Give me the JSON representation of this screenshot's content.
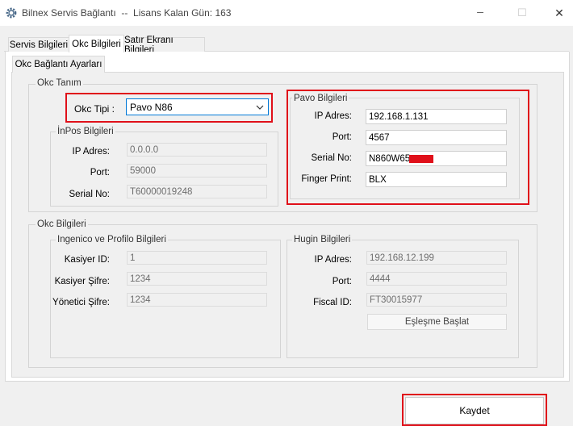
{
  "window": {
    "title": "Bilnex Servis Bağlantı  --  Lisans Kalan Gün: 163",
    "minimize_glyph": "─",
    "maximize_glyph": "☐",
    "close_glyph": "✕"
  },
  "tabs": [
    {
      "label": "Servis Bilgileri"
    },
    {
      "label": "Okc Bilgileri",
      "active": true
    },
    {
      "label": "Satır Ekranı Bilgileri"
    }
  ],
  "subtab": {
    "label": "Okc Bağlantı Ayarları"
  },
  "okc_tanim": {
    "legend": "Okc Tanım",
    "okc_tipi": {
      "label": "Okc Tipi :",
      "value": "Pavo N86"
    },
    "inpos": {
      "legend": "İnPos Bilgileri",
      "ip": {
        "label": "IP Adres:",
        "value": "0.0.0.0"
      },
      "port": {
        "label": "Port:",
        "value": "59000"
      },
      "serial": {
        "label": "Serial No:",
        "value": "T60000019248"
      }
    },
    "pavo": {
      "legend": "Pavo Bilgileri",
      "ip": {
        "label": "IP Adres:",
        "value": "192.168.1.131"
      },
      "port": {
        "label": "Port:",
        "value": "4567"
      },
      "serial": {
        "label": "Serial No:",
        "value": "N860W65"
      },
      "finger": {
        "label": "Finger Print:",
        "value": "BLX"
      }
    }
  },
  "okc_bilgileri": {
    "legend": "Okc Bilgileri",
    "ingenico": {
      "legend": "Ingenico ve Profilo Bilgileri",
      "kasiyer_id": {
        "label": "Kasiyer ID:",
        "value": "1"
      },
      "kasiyer_sifre": {
        "label": "Kasiyer Şifre:",
        "value": "1234"
      },
      "yonetici_sifre": {
        "label": "Yönetici Şifre:",
        "value": "1234"
      }
    },
    "hugin": {
      "legend": "Hugin Bilgileri",
      "ip": {
        "label": "IP Adres:",
        "value": "192.168.12.199"
      },
      "port": {
        "label": "Port:",
        "value": "4444"
      },
      "fiscal": {
        "label": "Fiscal ID:",
        "value": "FT30015977"
      },
      "pair_button": "Eşleşme Başlat"
    }
  },
  "footer": {
    "save_button": "Kaydet"
  },
  "colors": {
    "highlight": "#e0101a",
    "focus_border": "#0078d7"
  },
  "icons": {
    "app": "gear-icon",
    "dropdown": "chevron-down-icon"
  }
}
